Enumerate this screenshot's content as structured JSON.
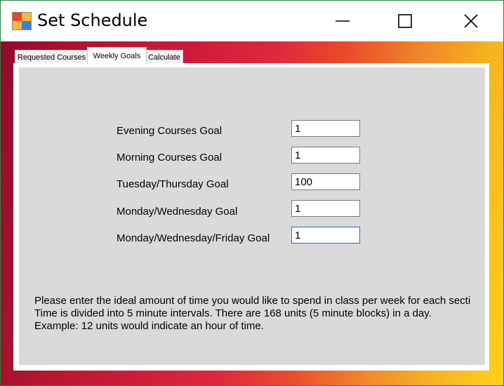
{
  "window": {
    "title": "Set Schedule"
  },
  "tabs": [
    {
      "label": "Requested Courses",
      "active": false
    },
    {
      "label": "Weekly Goals",
      "active": true
    },
    {
      "label": "Calculate",
      "active": false
    }
  ],
  "goals": [
    {
      "label": "Evening Courses Goal",
      "value": "1"
    },
    {
      "label": "Morning Courses Goal",
      "value": "1"
    },
    {
      "label": "Tuesday/Thursday Goal",
      "value": "100"
    },
    {
      "label": "Monday/Wednesday Goal",
      "value": "1"
    },
    {
      "label": "Monday/Wednesday/Friday Goal",
      "value": "1"
    }
  ],
  "info": {
    "line1": "Please enter the ideal amount of time you would like to spend in class per week for each secti",
    "line2": "Time is divided into 5 minute intervals. There are 168 units (5 minute blocks) in a day.",
    "line3": "Example: 12 units would indicate an hour of time."
  },
  "colors": {
    "window_border": "#1f8a3a",
    "panel_background": "#dadada",
    "focus_border": "#1f6fd1"
  },
  "icons": {
    "app": "app-icon",
    "minimize": "minimize-icon",
    "maximize": "maximize-icon",
    "close": "close-icon"
  }
}
